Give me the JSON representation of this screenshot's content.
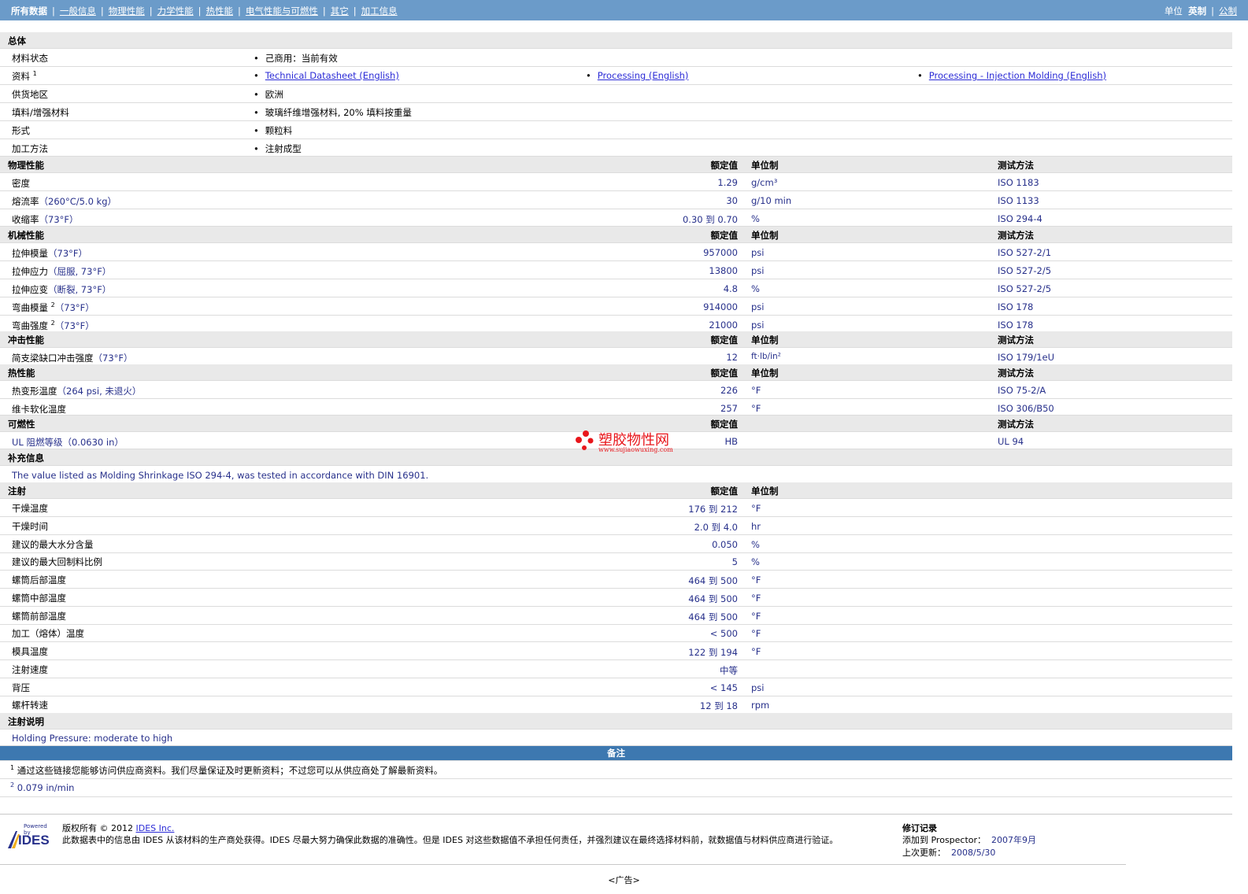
{
  "nav": {
    "items": [
      "所有数据",
      "一般信息",
      "物理性能",
      "力学性能",
      "热性能",
      "电气性能与可燃性",
      "其它",
      "加工信息"
    ],
    "units_label": "单位",
    "unit_en": "英制",
    "unit_metric": "公制"
  },
  "general": {
    "title": "总体",
    "rows": [
      {
        "label": "材料状态",
        "values": [
          "己商用：当前有效"
        ]
      },
      {
        "label": "资料",
        "sup": "1",
        "links": [
          "Technical Datasheet (English)",
          "Processing (English)",
          "Processing - Injection Molding (English)"
        ]
      },
      {
        "label": "供货地区",
        "values": [
          "欧洲"
        ]
      },
      {
        "label": "填料/增强材料",
        "values": [
          "玻璃纤维增强材料, 20% 填料按重量"
        ]
      },
      {
        "label": "形式",
        "values": [
          "颗粒料"
        ]
      },
      {
        "label": "加工方法",
        "values": [
          "注射成型"
        ]
      }
    ]
  },
  "cols": {
    "value": "额定值",
    "unit": "单位制",
    "method": "测试方法"
  },
  "physical": {
    "title": "物理性能",
    "rows": [
      {
        "label": "密度",
        "cond": "",
        "value": "1.29",
        "unit": "g/cm³",
        "method": "ISO 1183"
      },
      {
        "label": "熔流率",
        "cond": "（260°C/5.0 kg）",
        "value": "30",
        "unit": "g/10 min",
        "method": "ISO 1133"
      },
      {
        "label": "收缩率",
        "cond": "（73°F）",
        "value": "0.30 到  0.70",
        "unit": "%",
        "method": "ISO 294-4"
      }
    ]
  },
  "mechanical": {
    "title": "机械性能",
    "rows": [
      {
        "label": "拉伸模量",
        "cond": "（73°F）",
        "value": "957000",
        "unit": "psi",
        "method": "ISO 527-2/1"
      },
      {
        "label": "拉伸应力",
        "cond": "（屈服, 73°F）",
        "value": "13800",
        "unit": "psi",
        "method": "ISO 527-2/5"
      },
      {
        "label": "拉伸应变",
        "cond": "（断裂, 73°F）",
        "value": "4.8",
        "unit": "%",
        "method": "ISO 527-2/5"
      },
      {
        "label": "弯曲模量",
        "sup": "2",
        "cond": "（73°F）",
        "value": "914000",
        "unit": "psi",
        "method": "ISO 178"
      },
      {
        "label": "弯曲强度",
        "sup": "2",
        "cond": "（73°F）",
        "value": "21000",
        "unit": "psi",
        "method": "ISO 178"
      }
    ]
  },
  "impact": {
    "title": "冲击性能",
    "rows": [
      {
        "label": "简支梁缺口冲击强度",
        "cond": "（73°F）",
        "value": "12",
        "unit": "ft·lb/in²",
        "method": "ISO 179/1eU"
      }
    ]
  },
  "thermal": {
    "title": "热性能",
    "rows": [
      {
        "label": "热变形温度",
        "cond": "（264 psi, 未退火）",
        "value": "226",
        "unit": "°F",
        "method": "ISO 75-2/A"
      },
      {
        "label": "维卡软化温度",
        "cond": "",
        "value": "257",
        "unit": "°F",
        "method": "ISO 306/B50"
      }
    ]
  },
  "flammability": {
    "title": "可燃性",
    "rows": [
      {
        "label": "UL 阻燃等级",
        "cond": "（0.0630 in）",
        "value": "HB",
        "unit": "",
        "method": "UL 94"
      }
    ]
  },
  "supplement": {
    "title": "补充信息",
    "text": "The value listed as Molding Shrinkage ISO 294-4, was tested in accordance with DIN 16901."
  },
  "injection": {
    "title": "注射",
    "rows": [
      {
        "label": "干燥温度",
        "value": "176 到  212",
        "unit": "°F"
      },
      {
        "label": "干燥时间",
        "value": "2.0 到  4.0",
        "unit": "hr"
      },
      {
        "label": "建议的最大水分含量",
        "value": "0.050",
        "unit": "%"
      },
      {
        "label": "建议的最大回制料比例",
        "value": "5",
        "unit": "%"
      },
      {
        "label": "螺筒后部温度",
        "value": "464 到  500",
        "unit": "°F"
      },
      {
        "label": "螺筒中部温度",
        "value": "464 到  500",
        "unit": "°F"
      },
      {
        "label": "螺筒前部温度",
        "value": "464 到  500",
        "unit": "°F"
      },
      {
        "label": "加工（熔体）温度",
        "value": "< 500",
        "unit": "°F"
      },
      {
        "label": "模具温度",
        "value": "122 到  194",
        "unit": "°F"
      },
      {
        "label": "注射速度",
        "value": "中等",
        "unit": ""
      },
      {
        "label": "背压",
        "value": "< 145",
        "unit": "psi"
      },
      {
        "label": "螺杆转速",
        "value": "12 到  18",
        "unit": "rpm"
      }
    ]
  },
  "inj_notes": {
    "title": "注射说明",
    "text": "Holding Pressure: moderate to high"
  },
  "remarks": {
    "title": "备注",
    "notes": [
      {
        "sup": "1",
        "text": "通过这些链接您能够访问供应商资料。我们尽量保证及时更新资料；不过您可以从供应商处了解最新资料。"
      },
      {
        "sup": "2",
        "text": "0.079 in/min"
      }
    ]
  },
  "footer": {
    "logo_small": "Powered by",
    "logo_text": "IDES",
    "copyright": "版权所有  © 2012",
    "company_link": "IDES Inc.",
    "disclaimer": "此数据表中的信息由  IDES 从该材料的生产商处获得。IDES 尽最大努力确保此数据的准确性。但是  IDES 对这些数据值不承担任何责任，并强烈建议在最终选择材料前，就数据值与材料供应商进行验证。",
    "rev_title": "修订记录",
    "added_label": "添加到  Prospector：",
    "added_value": "2007年9月",
    "updated_label": "上次更新：",
    "updated_value": "2008/5/30",
    "ad": "<广告>"
  },
  "watermark": {
    "text": "塑胶物性网",
    "url": "www.sujiaowuxing.com",
    "color": "#e8161b"
  }
}
